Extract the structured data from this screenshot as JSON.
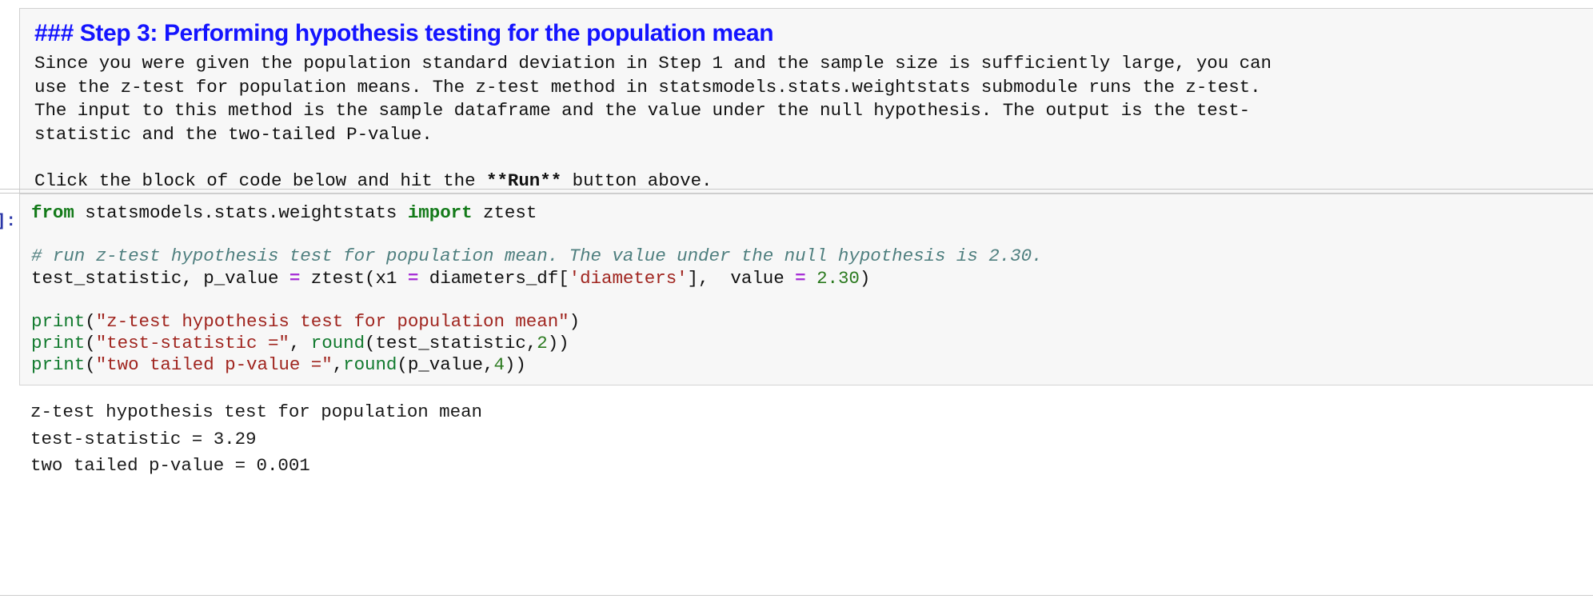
{
  "markdown_cell": {
    "heading": "### Step 3: Performing hypothesis testing for the population mean",
    "heading_color": "#1414ff",
    "paragraph_lines": [
      "Since you were given the population standard deviation in Step 1 and the sample size is sufficiently large, you can",
      "use the z-test for population means. The z-test method in statsmodels.stats.weightstats submodule runs the z-test.",
      "The input to this method is the sample dataframe and the value under the null hypothesis. The output is the test-",
      "statistic and the two-tailed P-value."
    ],
    "instruction": {
      "before": "Click the block of code below and hit the ",
      "bold": "**Run**",
      "after": " button above."
    }
  },
  "code_cell": {
    "prompt": "]:",
    "lines": [
      {
        "type": "code",
        "tokens": [
          {
            "text": "from",
            "style": "kw"
          },
          {
            "text": " statsmodels.stats.weightstats ",
            "style": "plain"
          },
          {
            "text": "import",
            "style": "kw"
          },
          {
            "text": " ztest",
            "style": "plain"
          }
        ]
      },
      {
        "type": "blank",
        "tokens": []
      },
      {
        "type": "code",
        "tokens": [
          {
            "text": "# run z-test hypothesis test for population mean. The value under the null hypothesis is 2.30.",
            "style": "comment"
          }
        ]
      },
      {
        "type": "code",
        "tokens": [
          {
            "text": "test_statistic, p_value ",
            "style": "plain"
          },
          {
            "text": "=",
            "style": "op"
          },
          {
            "text": " ztest(x1 ",
            "style": "plain"
          },
          {
            "text": "=",
            "style": "op"
          },
          {
            "text": " diameters_df[",
            "style": "plain"
          },
          {
            "text": "'diameters'",
            "style": "str"
          },
          {
            "text": "],  value ",
            "style": "plain"
          },
          {
            "text": "=",
            "style": "op"
          },
          {
            "text": " ",
            "style": "plain"
          },
          {
            "text": "2.30",
            "style": "num"
          },
          {
            "text": ")",
            "style": "plain"
          }
        ]
      },
      {
        "type": "blank",
        "tokens": []
      },
      {
        "type": "code",
        "tokens": [
          {
            "text": "print",
            "style": "builtin"
          },
          {
            "text": "(",
            "style": "plain"
          },
          {
            "text": "\"z-test hypothesis test for population mean\"",
            "style": "str"
          },
          {
            "text": ")",
            "style": "plain"
          }
        ]
      },
      {
        "type": "code",
        "tokens": [
          {
            "text": "print",
            "style": "builtin"
          },
          {
            "text": "(",
            "style": "plain"
          },
          {
            "text": "\"test-statistic =\"",
            "style": "str"
          },
          {
            "text": ", ",
            "style": "plain"
          },
          {
            "text": "round",
            "style": "builtin"
          },
          {
            "text": "(test_statistic,",
            "style": "plain"
          },
          {
            "text": "2",
            "style": "num"
          },
          {
            "text": "))",
            "style": "plain"
          }
        ]
      },
      {
        "type": "code",
        "tokens": [
          {
            "text": "print",
            "style": "builtin"
          },
          {
            "text": "(",
            "style": "plain"
          },
          {
            "text": "\"two tailed p-value =\"",
            "style": "str"
          },
          {
            "text": ",",
            "style": "plain"
          },
          {
            "text": "round",
            "style": "builtin"
          },
          {
            "text": "(p_value,",
            "style": "plain"
          },
          {
            "text": "4",
            "style": "num"
          },
          {
            "text": "))",
            "style": "plain"
          }
        ]
      }
    ]
  },
  "output": {
    "lines": [
      "z-test hypothesis test for population mean",
      "test-statistic = 3.29",
      "two tailed p-value = 0.001"
    ]
  },
  "syntax_colors": {
    "keyword": "#137a19",
    "builtin": "#117a2e",
    "comment": "#4f7f7f",
    "string": "#a0251f",
    "number": "#2b7a1f",
    "operator": "#a832d6",
    "plain": "#111111",
    "prompt": "#2b37a8"
  }
}
